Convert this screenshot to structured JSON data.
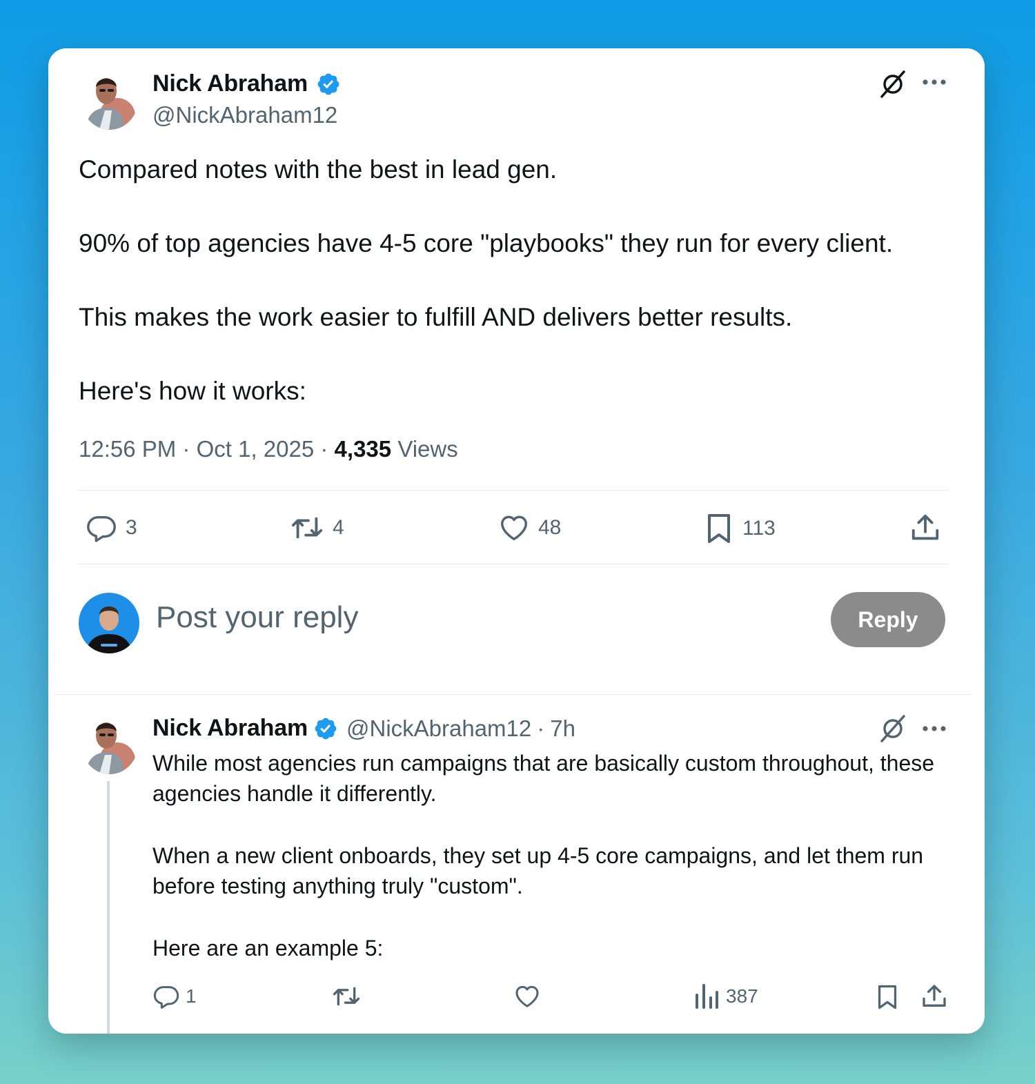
{
  "tweet": {
    "author_name": "Nick Abraham",
    "author_handle": "@NickAbraham12",
    "paragraphs": [
      "Compared notes with the best in lead gen.",
      "90% of top agencies have 4-5 core \"playbooks\" they run for every client.",
      "This makes the work easier to fulfill AND delivers better results.",
      "Here's how it works:"
    ],
    "time": "12:56 PM",
    "date": "Oct 1, 2025",
    "views_count": "4,335",
    "views_label": "Views",
    "separator": "·",
    "stats": {
      "replies": "3",
      "reposts": "4",
      "likes": "48",
      "bookmarks": "113"
    }
  },
  "composer": {
    "placeholder": "Post your reply",
    "button_label": "Reply"
  },
  "reply": {
    "author_name": "Nick Abraham",
    "author_handle": "@NickAbraham12",
    "age": "7h",
    "separator": "·",
    "paragraphs": [
      "While most agencies run campaigns that are basically custom throughout, these agencies handle it differently.",
      "When a new client onboards, they set up 4-5 core campaigns, and let them run before testing anything truly \"custom\".",
      "Here are an example 5:"
    ],
    "stats": {
      "replies": "1",
      "views": "387"
    }
  },
  "icons": {
    "verified": "verified-badge-icon",
    "grok": "grok-icon",
    "more": "more-icon",
    "reply": "reply-icon",
    "repost": "repost-icon",
    "like": "like-icon",
    "bookmark": "bookmark-icon",
    "share": "share-icon",
    "views": "views-icon"
  },
  "colors": {
    "verified": "#1d9bf0",
    "secondary_text": "#536471",
    "reply_button": "#8b8b8b"
  }
}
